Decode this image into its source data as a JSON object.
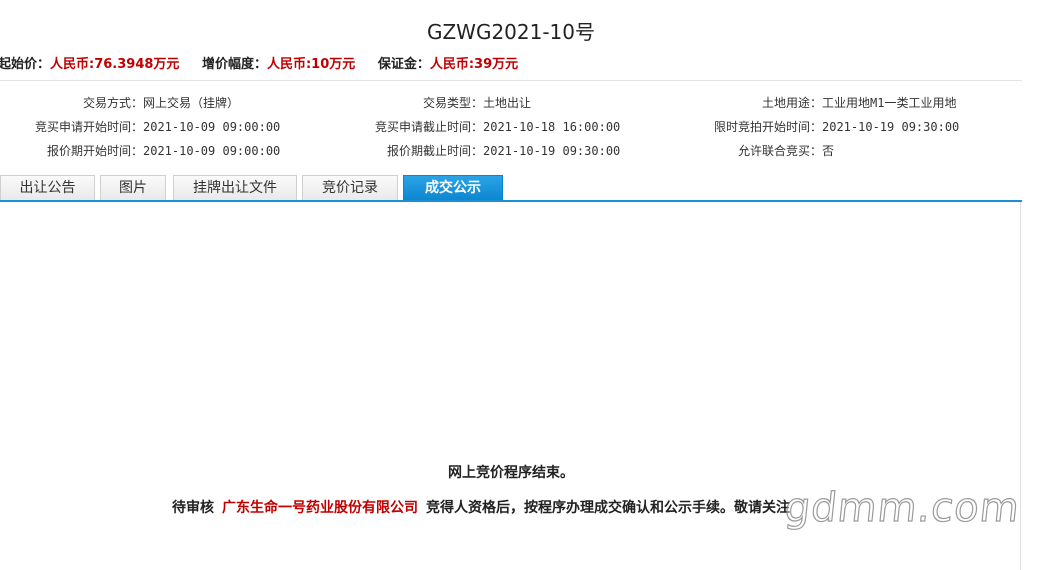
{
  "title": "GZWG2021-10号",
  "prices": [
    {
      "label": "起始价：",
      "value": "人民币:76.3948万元"
    },
    {
      "label": "增价幅度：",
      "value": "人民币:10万元"
    },
    {
      "label": "保证金：",
      "value": "人民币:39万元"
    }
  ],
  "info": {
    "rows": [
      [
        {
          "label": "交易方式：",
          "value": "网上交易（挂牌）"
        },
        {
          "label": "交易类型：",
          "value": "土地出让"
        },
        {
          "label": "土地用途：",
          "value": "工业用地M1一类工业用地"
        }
      ],
      [
        {
          "label": "竞买申请开始时间：",
          "value": "2021-10-09 09:00:00"
        },
        {
          "label": "竞买申请截止时间：",
          "value": "2021-10-18 16:00:00"
        },
        {
          "label": "限时竞拍开始时间：",
          "value": "2021-10-19 09:30:00"
        }
      ],
      [
        {
          "label": "报价期开始时间：",
          "value": "2021-10-09 09:00:00"
        },
        {
          "label": "报价期截止时间：",
          "value": "2021-10-19 09:30:00"
        },
        {
          "label": "允许联合竞买：",
          "value": "否"
        }
      ]
    ]
  },
  "tabs": [
    {
      "label": "出让公告",
      "active": false
    },
    {
      "label": "图片",
      "active": false
    },
    {
      "label": "挂牌出让文件",
      "active": false
    },
    {
      "label": "竞价记录",
      "active": false
    },
    {
      "label": "成交公示",
      "active": true
    }
  ],
  "result": {
    "line1": "网上竞价程序结束。",
    "line2_prefix": "待审核",
    "company": "广东生命一号药业股份有限公司",
    "line2_suffix": "竞得人资格后，按程序办理成交确认和公示手续。敬请关注"
  },
  "watermark": "gdmm.com",
  "colors": {
    "accent": "#0b84cf",
    "highlight": "#c00000"
  }
}
